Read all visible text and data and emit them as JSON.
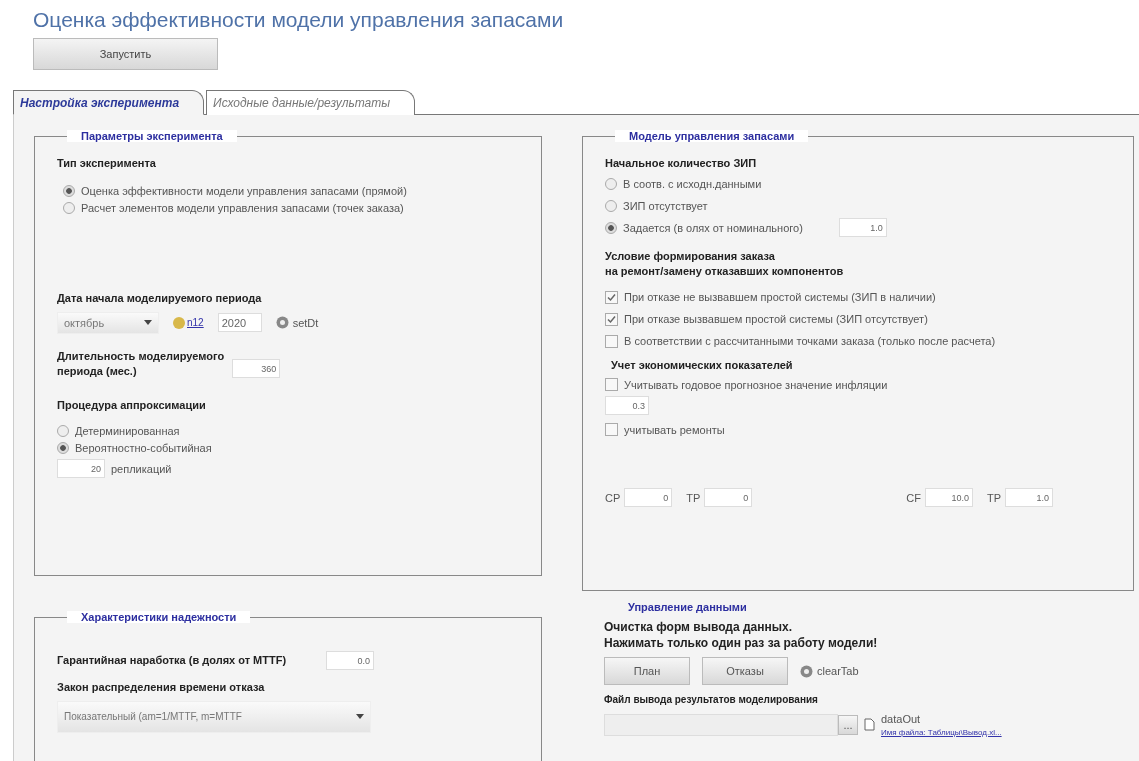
{
  "title": "Оценка эффективности модели управления запасами",
  "run_button": "Запустить",
  "tabs": [
    {
      "label": "Настройка эксперимента",
      "selected": true
    },
    {
      "label": "Исходные данные/результаты",
      "selected": false
    }
  ],
  "experiment": {
    "legend": "Параметры эксперимента",
    "type_label": "Тип эксперимента",
    "types": [
      {
        "label": "Оценка эффективности модели управления запасами (прямой)",
        "selected": true
      },
      {
        "label": "Расчет элементов модели управления запасами (точек заказа)",
        "selected": false
      }
    ],
    "start_label": "Дата начала моделируемого периода",
    "month": "октябрь",
    "calendar_link": "n12",
    "year": "2020",
    "set_label": "setDt",
    "duration_label": [
      "Длительность моделируемого",
      "периода (мес.)"
    ],
    "duration": "360",
    "approx_label": "Процедура аппроксимации",
    "approx": [
      {
        "label": "Детерминированная",
        "selected": false
      },
      {
        "label": "Вероятностно-событийная",
        "selected": true
      }
    ],
    "replications": "20",
    "replications_label": "репликаций"
  },
  "reliability": {
    "legend": "Характеристики надежности",
    "warranty_label": "Гарантийная наработка (в долях от MTTF)",
    "warranty": "0.0",
    "law_label": "Закон распределения времени отказа",
    "law": "Показательный (am=1/MTTF, m=MTTF"
  },
  "stock": {
    "legend": "Модель управления запасами",
    "initial_label": "Начальное количество ЗИП",
    "initial": [
      {
        "label": "В соотв. с исходн.данными",
        "selected": false
      },
      {
        "label": "ЗИП отсутствует",
        "selected": false
      },
      {
        "label": "Задается (в олях от номинального)",
        "selected": true
      }
    ],
    "percent": "1.0",
    "order_label": [
      "Условие формирования заказа",
      "на ремонт/замену отказавших компонентов"
    ],
    "orders": [
      {
        "label": "При отказе не вызвавшем простой системы (ЗИП в наличии)",
        "checked": true
      },
      {
        "label": "При отказе  вызвавшем простой системы (ЗИП отсутствует)",
        "checked": true
      },
      {
        "label": "В соответствии с рассчитанными точками заказа (только после расчета)",
        "checked": false
      }
    ],
    "econ_label": "Учет экономических показателей",
    "inflation": {
      "label": "Учитывать годовое прогнозное значение инфляции",
      "checked": false
    },
    "inflation_value": "0.3",
    "repairs": {
      "label": "учитывать ремонты",
      "checked": false
    },
    "costs": [
      {
        "label": "CP",
        "value": "0"
      },
      {
        "label": "TP",
        "value": "0"
      },
      {
        "label": "CF",
        "value": "10.0"
      },
      {
        "label": "TP",
        "value": "1.0"
      }
    ]
  },
  "data": {
    "legend": "Управление данными",
    "note": [
      "Очистка форм вывода данных.",
      "Нажимать только один раз за работу модели!"
    ],
    "buttons": [
      "План",
      "Отказы"
    ],
    "clear_label": "clearTab",
    "file_label": "Файл вывода результатов моделирования",
    "browse": "...",
    "out_label": "dataOut",
    "file_link": "Имя файла: Таблицы\\Вывод.xl..."
  }
}
